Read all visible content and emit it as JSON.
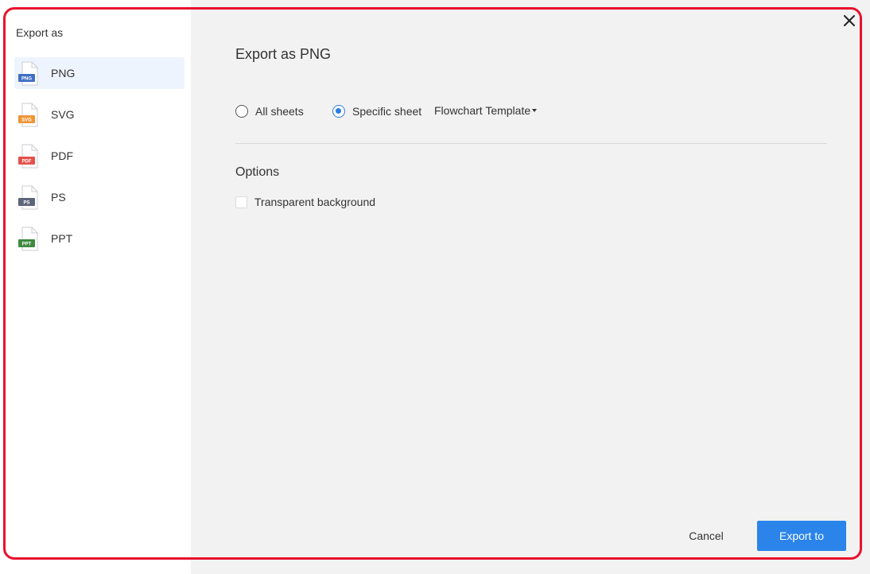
{
  "sidebar": {
    "title": "Export as",
    "formats": [
      {
        "label": "PNG",
        "badge": "PNG",
        "color": "#3f6fc4",
        "active": true
      },
      {
        "label": "SVG",
        "badge": "SVG",
        "color": "#f09437",
        "active": false
      },
      {
        "label": "PDF",
        "badge": "PDF",
        "color": "#e5504a",
        "active": false
      },
      {
        "label": "PS",
        "badge": "PS",
        "color": "#5b6478",
        "active": false
      },
      {
        "label": "PPT",
        "badge": "PPT",
        "color": "#3f8a3f",
        "active": false
      }
    ]
  },
  "main": {
    "title": "Export as PNG",
    "scope": {
      "all_label": "All sheets",
      "all_checked": false,
      "specific_label": "Specific sheet",
      "specific_checked": true,
      "selected_sheet": "Flowchart Template"
    },
    "options": {
      "title": "Options",
      "transparent_label": "Transparent background",
      "transparent_checked": false
    }
  },
  "footer": {
    "cancel_label": "Cancel",
    "export_label": "Export to"
  },
  "colors": {
    "accent": "#2a84ea",
    "highlight_frame": "#e8112d",
    "active_item_bg": "#eef4fd"
  },
  "icons": {
    "close": "close-icon"
  }
}
